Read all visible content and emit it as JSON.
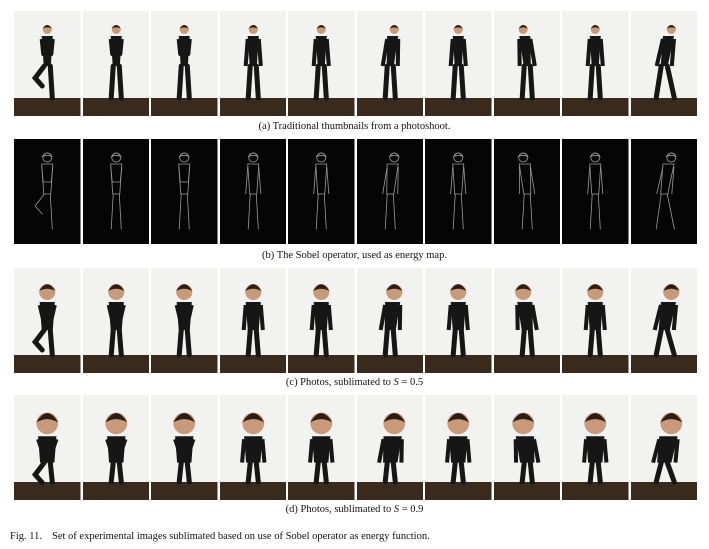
{
  "figure": {
    "label": "Fig. 11.",
    "caption": "Set of experimental images sublimated based on use of Sobel operator as energy function."
  },
  "rows": [
    {
      "id": "a",
      "caption": "(a) Traditional thumbnails from a photoshoot.",
      "style": "photo",
      "scale": 0.0
    },
    {
      "id": "b",
      "caption": "(b) The Sobel operator, used as energy map.",
      "style": "edges",
      "scale": 0.0
    },
    {
      "id": "c",
      "caption_prefix": "(c) Photos, sublimated to ",
      "caption_var": "S",
      "caption_suffix": " = 0.5",
      "style": "photo",
      "scale": 0.5
    },
    {
      "id": "d",
      "caption_prefix": "(d) Photos, sublimated to ",
      "caption_var": "S",
      "caption_suffix": " = 0.9",
      "style": "photo",
      "scale": 0.9
    }
  ],
  "poses": [
    "hop-left",
    "hands-front",
    "hands-front",
    "hands-pocket",
    "hands-pocket",
    "lean-right",
    "hands-pocket",
    "lean-left",
    "hands-pocket",
    "bend-right"
  ],
  "colors": {
    "wall": "#f2f2f0",
    "floor": "#3a2a1c",
    "clothes": "#161616",
    "skin": "#c99a7a",
    "hair": "#2a1e16",
    "edge_bg": "#050505",
    "edge_line": "#9a9a9a"
  }
}
